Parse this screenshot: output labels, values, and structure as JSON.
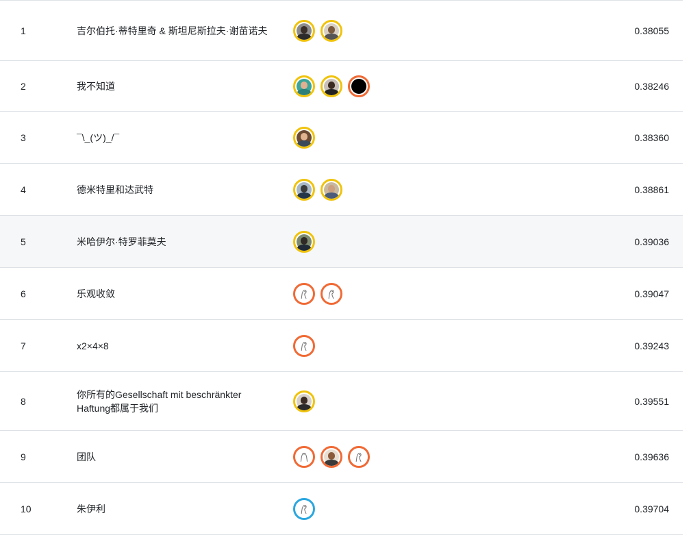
{
  "leaderboard": {
    "rows": [
      {
        "rank": "1",
        "team": "吉尔伯托·蒂特里奇 & 斯坦尼斯拉夫·谢苗诺夫",
        "score": "0.38055"
      },
      {
        "rank": "2",
        "team": "我不知道",
        "score": "0.38246"
      },
      {
        "rank": "3",
        "team": "¯\\_(ツ)_/¯",
        "score": "0.38360"
      },
      {
        "rank": "4",
        "team": "德米特里和达武特",
        "score": "0.38861"
      },
      {
        "rank": "5",
        "team": "米哈伊尔·特罗菲莫夫",
        "score": "0.39036"
      },
      {
        "rank": "6",
        "team": "乐观收敛",
        "score": "0.39047"
      },
      {
        "rank": "7",
        "team": "x2×4×8",
        "score": "0.39243"
      },
      {
        "rank": "8",
        "team": "你所有的Gesellschaft mit beschränkter Haftung都属于我们",
        "score": "0.39551"
      },
      {
        "rank": "9",
        "team": "团队",
        "score": "0.39636"
      },
      {
        "rank": "10",
        "team": "朱伊利",
        "score": "0.39704"
      }
    ]
  },
  "colors": {
    "gold_ring": "#f0c30c",
    "orange_ring": "#f06a35",
    "blue_ring": "#2aa7e0",
    "row_highlight": "#f6f7f8",
    "divider": "#dee2e6"
  }
}
